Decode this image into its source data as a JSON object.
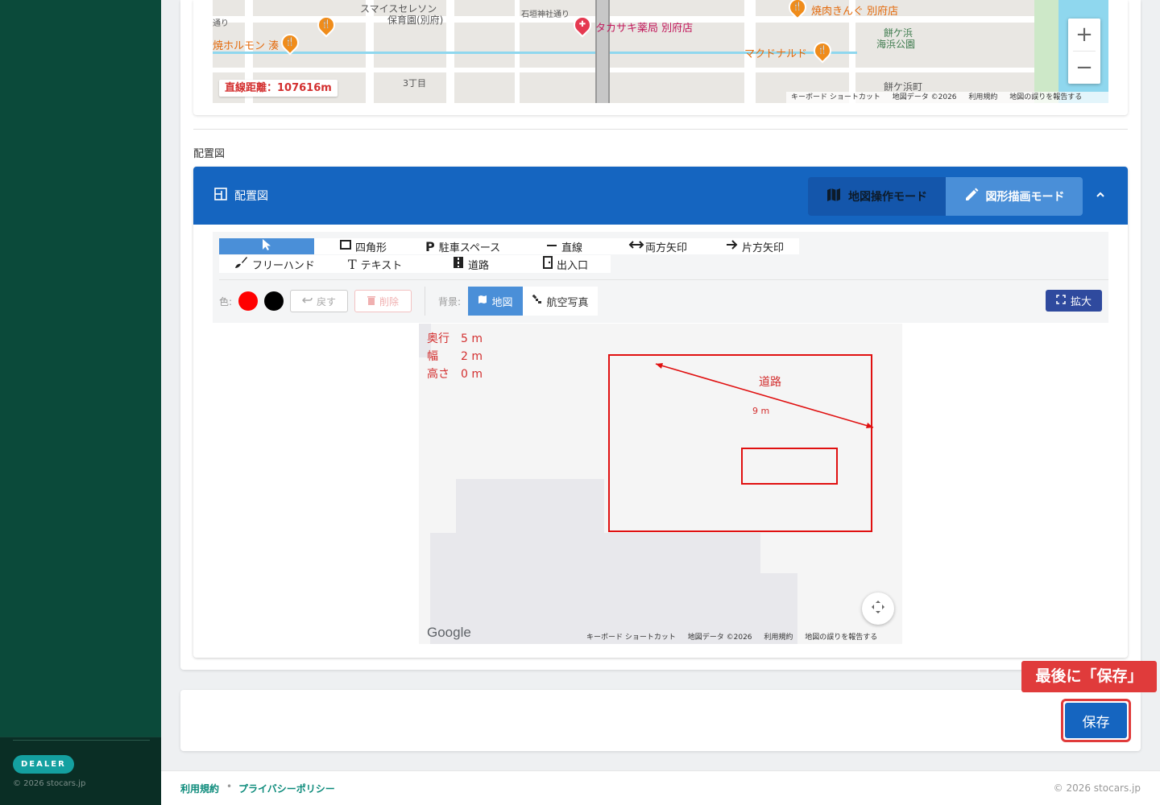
{
  "sidebar": {
    "badge": "DEALER",
    "copyright": "© 2026 stocars.jp"
  },
  "top_map": {
    "distance": "直線距離：107616m",
    "labels": {
      "school": "スマイスセレソン",
      "school2": "保育園(別府)",
      "shrine_street": "石垣神社通り",
      "pharmacy": "タカサキ薬局 別府店",
      "yakiniku": "焼肉きんぐ 別府店",
      "horumon": "焼ホルモン 湊",
      "mcd": "マクドナルド",
      "chome": "3丁目",
      "beach": "餅ケ浜",
      "beach_park": "海浜公園",
      "beach_town": "餅ケ浜町",
      "street_cut": "通り"
    },
    "zoom_in": "+",
    "zoom_out": "−",
    "footer": {
      "shortcut": "キーボード ショートカット",
      "map_data": "地図データ ©2026",
      "terms": "利用規約",
      "report": "地図の誤りを報告する"
    }
  },
  "section_label": "配置図",
  "panel": {
    "title": "配置図",
    "map_mode": "地図操作モード",
    "draw_mode": "図形描画モード",
    "collapse_icon": "chevron-up"
  },
  "tools": {
    "rect": "四角形",
    "parking": "駐車スペース",
    "line": "直線",
    "double_arrow": "両方矢印",
    "single_arrow": "片方矢印",
    "freehand": "フリーハンド",
    "text": "テキスト",
    "road": "道路",
    "entrance": "出入口"
  },
  "controls": {
    "color_label": "色:",
    "colors": [
      "#ff0000",
      "#000000"
    ],
    "undo": "戻す",
    "delete": "削除",
    "bg_label": "背景:",
    "bg_map": "地図",
    "bg_aerial": "航空写真",
    "expand": "拡大"
  },
  "canvas": {
    "depth_label": "奥行",
    "depth_value": "5 m",
    "width_label": "幅",
    "width_value": "2 m",
    "height_label": "高さ",
    "height_value": "0 m",
    "road_label": "道路",
    "arrow_label": "9 m",
    "google": "Google",
    "footer": {
      "shortcut": "キーボード ショートカット",
      "map_data": "地図データ ©2026",
      "terms": "利用規約",
      "report": "地図の誤りを報告する"
    }
  },
  "save": {
    "callout": "最後に「保存」",
    "button": "保存"
  },
  "footer": {
    "terms": "利用規約",
    "dot": "•",
    "privacy": "プライバシーポリシー",
    "copyright": "© 2026 stocars.jp"
  }
}
